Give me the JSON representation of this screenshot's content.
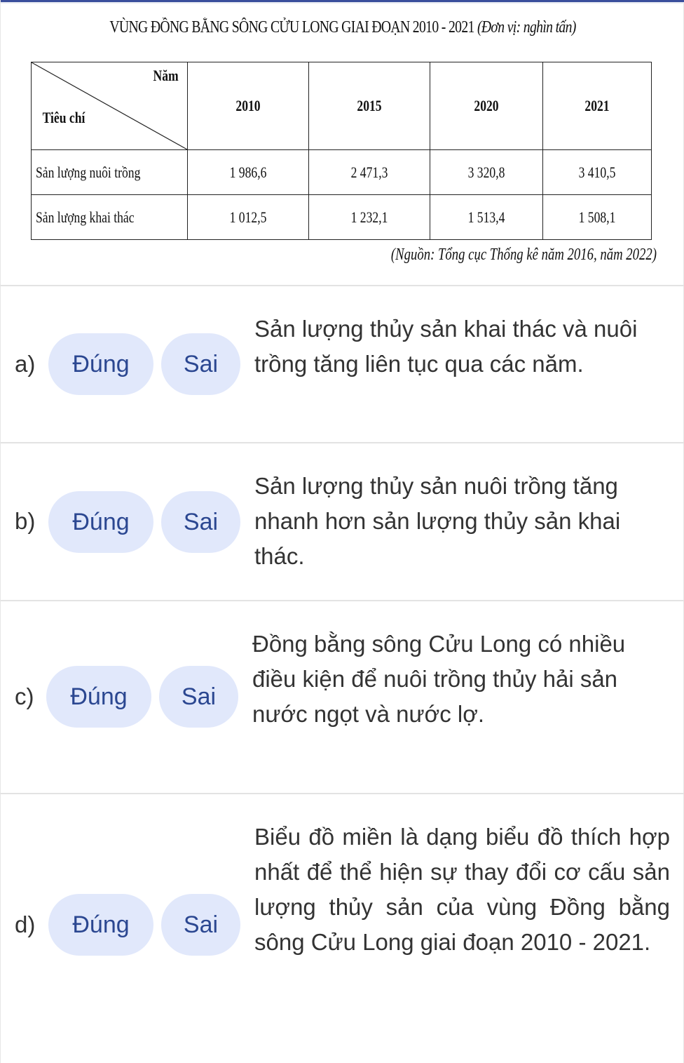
{
  "figure": {
    "title": "VÙNG ĐỒNG BẰNG SÔNG CỬU LONG GIAI ĐOẠN 2010 - 2021",
    "unit": "(Đơn vị: nghìn tấn)",
    "corner_top": "Năm",
    "corner_bottom": "Tiêu chí",
    "years": [
      "2010",
      "2015",
      "2020",
      "2021"
    ],
    "rows": [
      {
        "label": "Sản lượng nuôi trồng",
        "values": [
          "1 986,6",
          "2 471,3",
          "3 320,8",
          "3 410,5"
        ]
      },
      {
        "label": "Sản lượng khai thác",
        "values": [
          "1 012,5",
          "1 232,1",
          "1 513,4",
          "1 508,1"
        ]
      }
    ],
    "source": "(Nguồn: Tổng cục Thống kê năm 2016, năm 2022)"
  },
  "buttons": {
    "true_label": "Đúng",
    "false_label": "Sai"
  },
  "questions": [
    {
      "letter": "a)",
      "text": "Sản lượng thủy sản khai thác và nuôi trồng tăng liên tục qua các năm."
    },
    {
      "letter": "b)",
      "text": "Sản lượng thủy sản nuôi trồng tăng nhanh hơn sản lượng thủy sản khai thác."
    },
    {
      "letter": "c)",
      "text": "Đồng bằng sông Cửu Long có nhiều điều kiện để nuôi trồng thủy hải sản nước ngọt và nước lợ."
    },
    {
      "letter": "d)",
      "text": "Biểu đồ miền là dạng biểu đồ thích hợp nhất để thể hiện sự thay đổi cơ cấu sản lượng thủy sản của vùng Đồng bằng sông Cửu Long giai đoạn 2010 - 2021."
    }
  ],
  "colors": {
    "accent_bar": "#3a4e9c",
    "button_bg": "#e1e8fb",
    "button_text": "#2b4791",
    "body_text": "#333333"
  }
}
